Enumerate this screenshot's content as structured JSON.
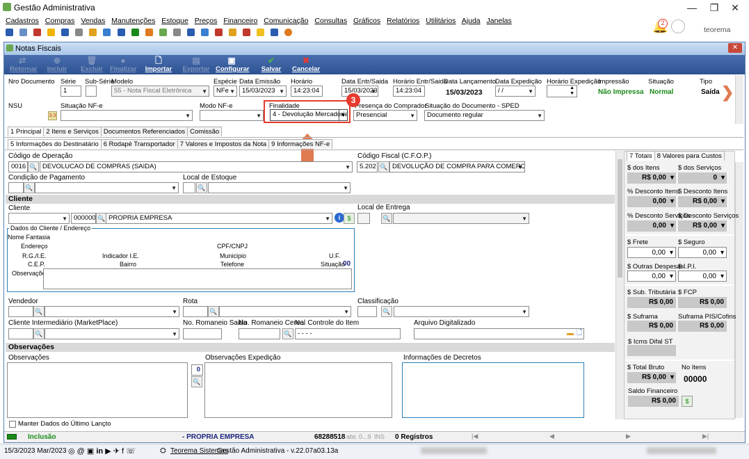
{
  "window": {
    "title": "Gestão Administrativa",
    "user": "teorema",
    "notif_count": "2"
  },
  "menu": [
    "Cadastros",
    "Compras",
    "Vendas",
    "Manutenções",
    "Estoque",
    "Preços",
    "Financeiro",
    "Comunicação",
    "Consultas",
    "Gráficos",
    "Relatórios",
    "Utilitários",
    "Ajuda",
    "Janelas"
  ],
  "form": {
    "title": "Notas Fiscais"
  },
  "toolbar": {
    "retornar": "Retornar",
    "incluir": "Incluir",
    "excluir": "Excluir",
    "finalizar": "Finalizar",
    "importar": "Importar",
    "exportar": "Exportar",
    "configurar": "Configurar",
    "salvar": "Salvar",
    "cancelar": "Cancelar"
  },
  "header": {
    "nro_documento_label": "Nro Documento",
    "serie_label": "Série",
    "sub_serie_label": "Sub-Série",
    "modelo_label": "Modelo",
    "serie_value": "1",
    "modelo_value": "55 - Nota Fiscal Eletrônica",
    "especie_label": "Espécie",
    "especie_value": "NFe",
    "data_emissao_label": "Data Emissão",
    "data_emissao_value": "15/03/2023",
    "horario_label": "Horário",
    "horario_value": "14:23:04",
    "data_entr_label": "Data Entr/Saida",
    "data_entr_value": "15/03/2023",
    "horario_entr_label": "Horário Entr/Saida",
    "horario_entr_value": "14:23:04",
    "data_lanc_label": "Data Lançamento",
    "data_lanc_value": "15/03/2023",
    "data_exped_label": "Data Expedição",
    "data_exped_value": "/ /",
    "horario_exped_label": "Horário Expedição",
    "impressao_label": "Impressão",
    "impressao_value": "Não Impressa",
    "situacao_label": "Situação",
    "situacao_value": "Normal",
    "tipo_label": "Tipo",
    "tipo_value": "Saída",
    "nsu_label": "NSU",
    "situacao_nfe_label": "Situação NF-e",
    "modo_nfe_label": "Modo NF-e",
    "finalidade_label": "Finalidade",
    "finalidade_value": "4 - Devolução Mercadoria",
    "presenca_label": "Presença do Comprador",
    "presenca_value": "Presencial",
    "sit_doc_label": "Situação do Documento - SPED",
    "sit_doc_value": "Documento regular",
    "badge_value": "3"
  },
  "tabs_main": [
    "1 Principal",
    "2 Itens e Serviços",
    "Documentos Referenciados",
    "Comissão"
  ],
  "tabs_sub": [
    "5 Informações do Destinatário",
    "6 Rodapé Transportador",
    "7 Valores e Impostos da Nota",
    "9 Informações NF-e"
  ],
  "destinatario": {
    "cod_operacao_label": "Código de Operação",
    "cod_operacao_code": "0016",
    "cod_operacao_desc": "DEVOLUCAO DE COMPRAS (SAIDA)",
    "cfop_label": "Código Fiscal (C.F.O.P.)",
    "cfop_code": "5.202",
    "cfop_desc": "DEVOLUÇÃO DE COMPRA PARA COMERCIALIZAÇÃO",
    "cond_pag_label": "Condição de Pagamento",
    "local_estoque_label": "Local de Estoque",
    "cliente_section": "Cliente",
    "cliente_label": "Cliente",
    "cliente_code": "0000001",
    "cliente_name": "PROPRIA EMPRESA",
    "local_entrega_label": "Local de Entrega",
    "dados_title": "Dados do Cliente / Endereço",
    "nome_fantasia": "Nome Fantasia",
    "endereco": "Endereço",
    "cpf_cnpj": "CPF/CNPJ",
    "rg_ie": "R.G./I.E.",
    "indicador_ie": "Indicador I.E.",
    "municipio": "Municipio",
    "uf": "U.F.",
    "cep": "C.E.P.",
    "bairro": "Bairro",
    "telefone": "Telefone",
    "situacao": "Situação",
    "situacao_value": "00",
    "observacoes": "Observações",
    "vendedor_label": "Vendedor",
    "rota_label": "Rota",
    "classificacao_label": "Classificação",
    "cli_inter_label": "Cliente Intermediário (MarketPlace)",
    "romaneio_saida_label": "No. Romaneio Saida",
    "romaneio_cereal_label": "No. Romaneio Cereal",
    "controle_item_label": "No. Controle do Item",
    "controle_item_value": "- - - -",
    "arquivo_label": "Arquivo Digitalizado"
  },
  "observacoes_section": {
    "title": "Observações",
    "obs_label": "Observações",
    "obs_exped_label": "Observações Expedição",
    "info_decretos_label": "Informações de Decretos",
    "counter": "0"
  },
  "totais": {
    "tabs": [
      "7 Totais",
      "8 Valores para Custos"
    ],
    "dos_itens_label": "$ dos Itens",
    "dos_itens": "R$ 0,00",
    "dos_servicos_label": "$ dos Serviços",
    "dos_servicos": "0",
    "desc_itens_label": "% Desconto Itens",
    "desc_itens": "0,00",
    "desc_itens2_label": "$ Desconto Itens",
    "desc_itens2": "R$ 0,00",
    "desc_serv_label": "% Desconto Serviços",
    "desc_serv": "0,00",
    "desc_serv2_label": "$ Desconto Serviços",
    "desc_serv2": "R$ 0,00",
    "frete_label": "$ Frete",
    "frete": "0,00",
    "seguro_label": "$ Seguro",
    "seguro": "0,00",
    "outras_label": "$ Outras Despesas",
    "outras": "0,00",
    "ipi_label": "$ I.P.I.",
    "ipi": "0,00",
    "sub_trib_label": "$ Sub. Tributária",
    "sub_trib": "R$ 0,00",
    "fcp_label": "$ FCP",
    "fcp": "R$ 0,00",
    "suframa_label": "$ Suframa",
    "suframa": "R$ 0,00",
    "suframa_pis_label": "Suframa PIS/Cofins",
    "suframa_pis": "R$ 0,00",
    "icms_difal_label": "$ Icms Difal ST",
    "total_bruto_label": "$ Total Bruto",
    "total_bruto": "R$ 0,00",
    "no_itens_label": "No Itens",
    "no_itens": "00000",
    "saldo_label": "Saldo Financeiro",
    "saldo": "R$ 0,00"
  },
  "footer": {
    "manter_label": "Manter Dados do Último Lançto",
    "status_mode": "Inclusão",
    "status_cliente": "- PROPRIA EMPRESA",
    "status_num": "68288518",
    "status_abc": "abc",
    "status_09": "0...9",
    "status_ins": "INS",
    "status_registros": "0 Registros"
  },
  "bottom": {
    "date": "15/3/2023 Mar/2023",
    "company": "Teorema Sistemas",
    "version": "Gestão Administrativa - v.22.07a03.13a"
  },
  "colors": {
    "toolbar": "#3a5fa0",
    "accent_red": "#e63b2e",
    "arrow": "#e07a50",
    "green": "#1a8a1a",
    "navy": "#1a237e"
  }
}
